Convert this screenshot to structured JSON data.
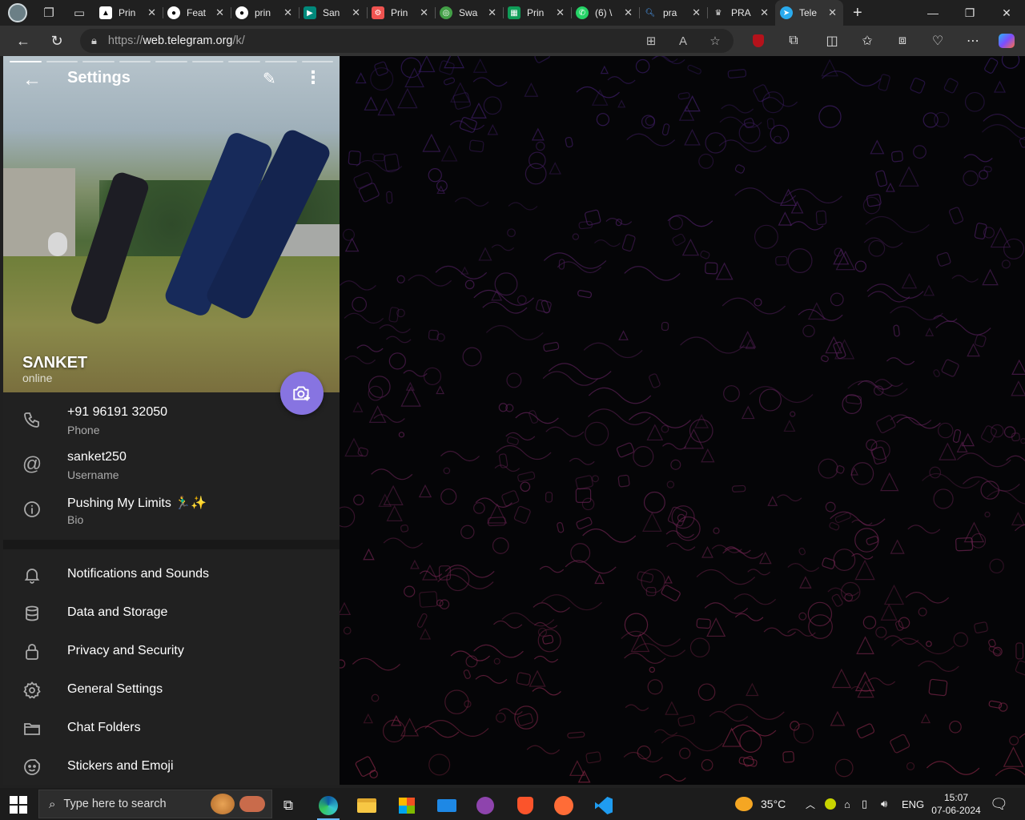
{
  "browser": {
    "tabs": [
      {
        "label": "Prin",
        "favicon": "triangle-icon",
        "color": "#000000"
      },
      {
        "label": "Feat",
        "favicon": "github-icon",
        "color": "#ffffff"
      },
      {
        "label": "prin",
        "favicon": "github-icon",
        "color": "#ffffff"
      },
      {
        "label": "San",
        "favicon": "meet-icon",
        "color": "#00897b"
      },
      {
        "label": "Prin",
        "favicon": "tool-icon",
        "color": "#ef5350"
      },
      {
        "label": "Swa",
        "favicon": "ball-icon",
        "color": "#43a047"
      },
      {
        "label": "Prin",
        "favicon": "sheets-icon",
        "color": "#0f9d58"
      },
      {
        "label": "(6) \\",
        "favicon": "whatsapp-icon",
        "color": "#25d366"
      },
      {
        "label": "pra",
        "favicon": "search-icon",
        "color": "#1565c0"
      },
      {
        "label": "PRA",
        "favicon": "crown-icon",
        "color": "#cccccc"
      },
      {
        "label": "Tele",
        "favicon": "telegram-icon",
        "color": "#2aabee",
        "active": true
      }
    ],
    "url_scheme": "https://",
    "url_host": "web.telegram.org",
    "url_path": "/k/"
  },
  "settings": {
    "title": "Settings",
    "profile_name": "SΛNKET",
    "profile_status": "online",
    "info": [
      {
        "value": "+91 96191 32050",
        "label": "Phone",
        "icon": "phone-icon"
      },
      {
        "value": "sanket250",
        "label": "Username",
        "icon": "at-icon"
      },
      {
        "value": "Pushing My Limits 🏃‍♂️✨",
        "label": "Bio",
        "icon": "info-icon"
      }
    ],
    "menu": [
      {
        "label": "Notifications and Sounds",
        "icon": "bell-icon"
      },
      {
        "label": "Data and Storage",
        "icon": "database-icon"
      },
      {
        "label": "Privacy and Security",
        "icon": "lock-icon"
      },
      {
        "label": "General Settings",
        "icon": "gear-icon"
      },
      {
        "label": "Chat Folders",
        "icon": "folder-icon"
      },
      {
        "label": "Stickers and Emoji",
        "icon": "sticker-icon"
      }
    ],
    "accent": "#8774e1"
  },
  "taskbar": {
    "search_placeholder": "Type here to search",
    "weather": "35°C",
    "language": "ENG",
    "time": "15:07",
    "date": "07-06-2024"
  }
}
